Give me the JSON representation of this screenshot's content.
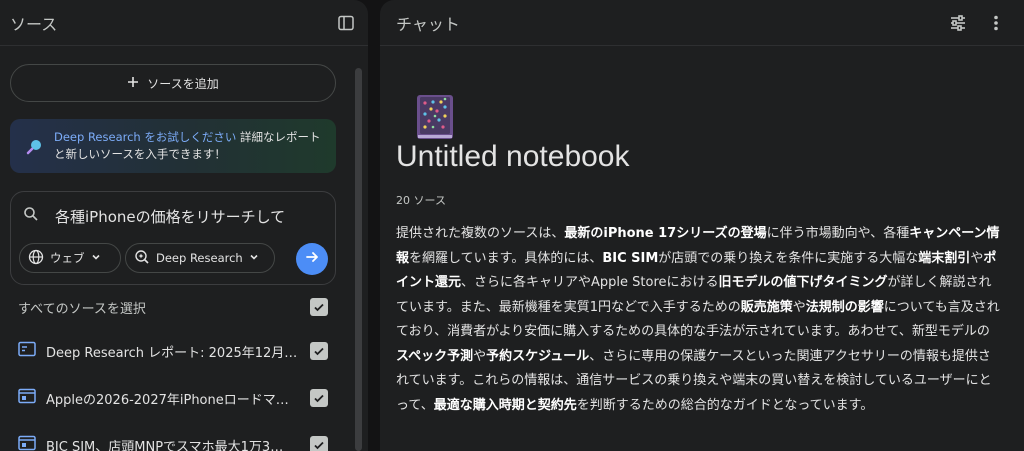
{
  "sources_panel": {
    "title": "ソース",
    "add_button_label": "ソースを追加",
    "promo": {
      "link_text": "Deep Research をお試しください",
      "text": " 詳細なレポートと新しいソースを入手できます！"
    },
    "search": {
      "value": "各種iPhoneの価格をリサーチして",
      "chip_web": "ウェブ",
      "chip_mode": "Deep Research"
    },
    "select_all_label": "すべてのソースを選択",
    "items": [
      {
        "label": "Deep Research レポート: 2025年12月…"
      },
      {
        "label": "Appleの2026-2027年iPhoneロードマ…"
      },
      {
        "label": "BIC SIM、店頭MNPでスマホ最大1万3…"
      }
    ]
  },
  "chat_panel": {
    "title": "チャット",
    "notebook_title": "Untitled notebook",
    "source_count": "20 ソース",
    "summary": [
      {
        "t": "提供された複数のソースは、"
      },
      {
        "t": "最新のiPhone 17シリーズの登場",
        "b": true
      },
      {
        "t": "に伴う市場動向や、各種"
      },
      {
        "t": "キャンペーン情報",
        "b": true
      },
      {
        "t": "を網羅しています。具体的には、"
      },
      {
        "t": "BIC SIM",
        "b": true
      },
      {
        "t": "が店頭での乗り換えを条件に実施する大幅な"
      },
      {
        "t": "端末割引",
        "b": true
      },
      {
        "t": "や"
      },
      {
        "t": "ポイント還元",
        "b": true
      },
      {
        "t": "、さらに各キャリアやApple Storeにおける"
      },
      {
        "t": "旧モデルの値下げタイミング",
        "b": true
      },
      {
        "t": "が詳しく解説されています。また、最新機種を実質1円などで入手するための"
      },
      {
        "t": "販売施策",
        "b": true
      },
      {
        "t": "や"
      },
      {
        "t": "法規制の影響",
        "b": true
      },
      {
        "t": "についても言及されており、消費者がより安価に購入するための具体的な手法が示されています。あわせて、新型モデルの"
      },
      {
        "t": "スペック予測",
        "b": true
      },
      {
        "t": "や"
      },
      {
        "t": "予約スケジュール",
        "b": true
      },
      {
        "t": "、さらに専用の保護ケースといった関連アクセサリーの情報も提供されています。これらの情報は、通信サービスの乗り換えや端末の買い替えを検討しているユーザーにとって、"
      },
      {
        "t": "最適な購入時期と契約先",
        "b": true
      },
      {
        "t": "を判断するための総合的なガイドとなっています。"
      }
    ]
  },
  "colors": {
    "background": "#131314",
    "panel": "#1e1f20",
    "accent": "#4c8df6",
    "link": "#7cacf8"
  },
  "icons": [
    "panel-toggle-icon",
    "plus-icon",
    "search-icon",
    "globe-icon",
    "chevron-down-icon",
    "deep-research-icon",
    "arrow-right-icon",
    "check-icon",
    "source-file-icon",
    "tune-icon",
    "more-vert-icon",
    "notebook-icon"
  ]
}
